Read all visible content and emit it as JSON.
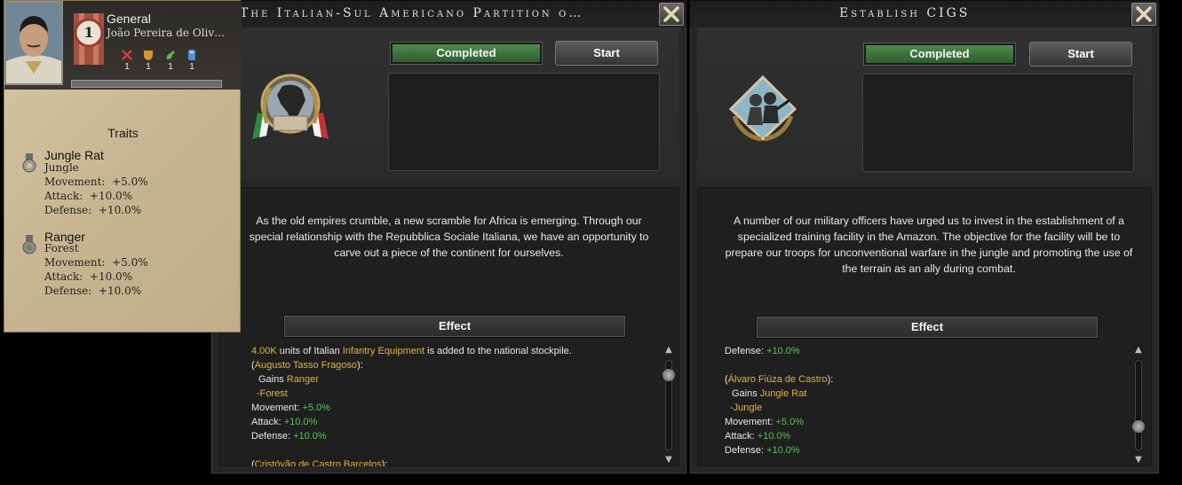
{
  "general": {
    "role": "General",
    "name": "João Pereira de Oliv…",
    "rank": "1",
    "skills": [
      {
        "icon": "attack-skill-icon",
        "value": "1"
      },
      {
        "icon": "defense-skill-icon",
        "value": "1"
      },
      {
        "icon": "planning-skill-icon",
        "value": "1"
      },
      {
        "icon": "logistics-skill-icon",
        "value": "1"
      }
    ],
    "traits_title": "Traits",
    "traits": [
      {
        "name": "Jungle Rat",
        "terrain": "Jungle",
        "stats": [
          "Movement:  +5.0%",
          "Attack:  +10.0%",
          "Defense:  +10.0%"
        ]
      },
      {
        "name": "Ranger",
        "terrain": "Forest",
        "stats": [
          "Movement:  +5.0%",
          "Attack:  +10.0%",
          "Defense:  +10.0%"
        ]
      }
    ]
  },
  "decision_a": {
    "title": "The Italian-Sul Americano Partition o…",
    "status": "Completed",
    "start_label": "Start",
    "description": "As the old empires crumble, a new scramble for Africa is emerging. Through our special relationship with the Repubblica Sociale Italiana, we have an opportunity to carve out a piece of the continent for ourselves.",
    "effect_header": "Effect",
    "effects": {
      "amount": "4.00K",
      "t1": " units of Italian ",
      "equipment": "Infantry Equipment",
      "t2": " is added to the national stockpile.",
      "general1": "Augusto Tasso Fragoso",
      "gains": "Gains ",
      "trait": "Ranger",
      "terrain": "-Forest",
      "movement_label": "Movement: ",
      "movement_value": "+5.0%",
      "attack_label": "Attack: ",
      "attack_value": "+10.0%",
      "defense_label": "Defense: ",
      "defense_value": "+10.0%",
      "general2": "Cristóvão de Castro Barcelos"
    }
  },
  "decision_b": {
    "title": "Establish CIGS",
    "status": "Completed",
    "start_label": "Start",
    "description": "A number of our military officers have urged us to invest in the establishment of a specialized training facility in the Amazon. The objective for the facility will be to prepare our troops for unconventional warfare in the jungle and promoting the use of the terrain as an ally during combat.",
    "effect_header": "Effect",
    "effects": {
      "defense_label": "Defense: ",
      "defense_value": "+10.0%",
      "general": "Álvaro Fiúza de Castro",
      "gains": "Gains ",
      "trait": "Jungle Rat",
      "terrain": "-Jungle",
      "movement_label": "Movement: ",
      "movement_value": "+5.0%",
      "attack_label": "Attack: ",
      "attack_value": "+10.0%"
    }
  },
  "colors": {
    "gold": "#e5b23a",
    "green": "#59c25a",
    "completed": "#3f7a40"
  }
}
